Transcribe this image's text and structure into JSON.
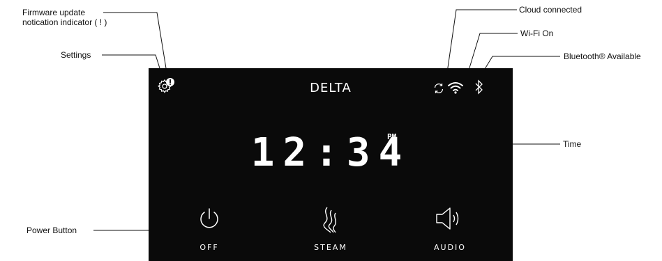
{
  "callouts": {
    "firmware": "Firmware update\nnotication indicator ( ! )",
    "settings": "Settings",
    "power": "Power Button",
    "cloud": "Cloud connected",
    "wifi": "Wi-Fi On",
    "bluetooth": "Bluetooth® Available",
    "time": "Time"
  },
  "screen": {
    "brand": "DELTA",
    "time": "12:34",
    "ampm": "PM",
    "buttons": [
      {
        "label": "OFF",
        "icon": "power-icon"
      },
      {
        "label": "STEAM",
        "icon": "steam-icon"
      },
      {
        "label": "AUDIO",
        "icon": "speaker-icon"
      }
    ],
    "status_icons": [
      "settings-icon",
      "sync-icon",
      "wifi-icon",
      "bluetooth-icon"
    ]
  },
  "colors": {
    "screen_bg": "#0a0a0a",
    "text": "#ffffff",
    "leader": "#111111"
  }
}
